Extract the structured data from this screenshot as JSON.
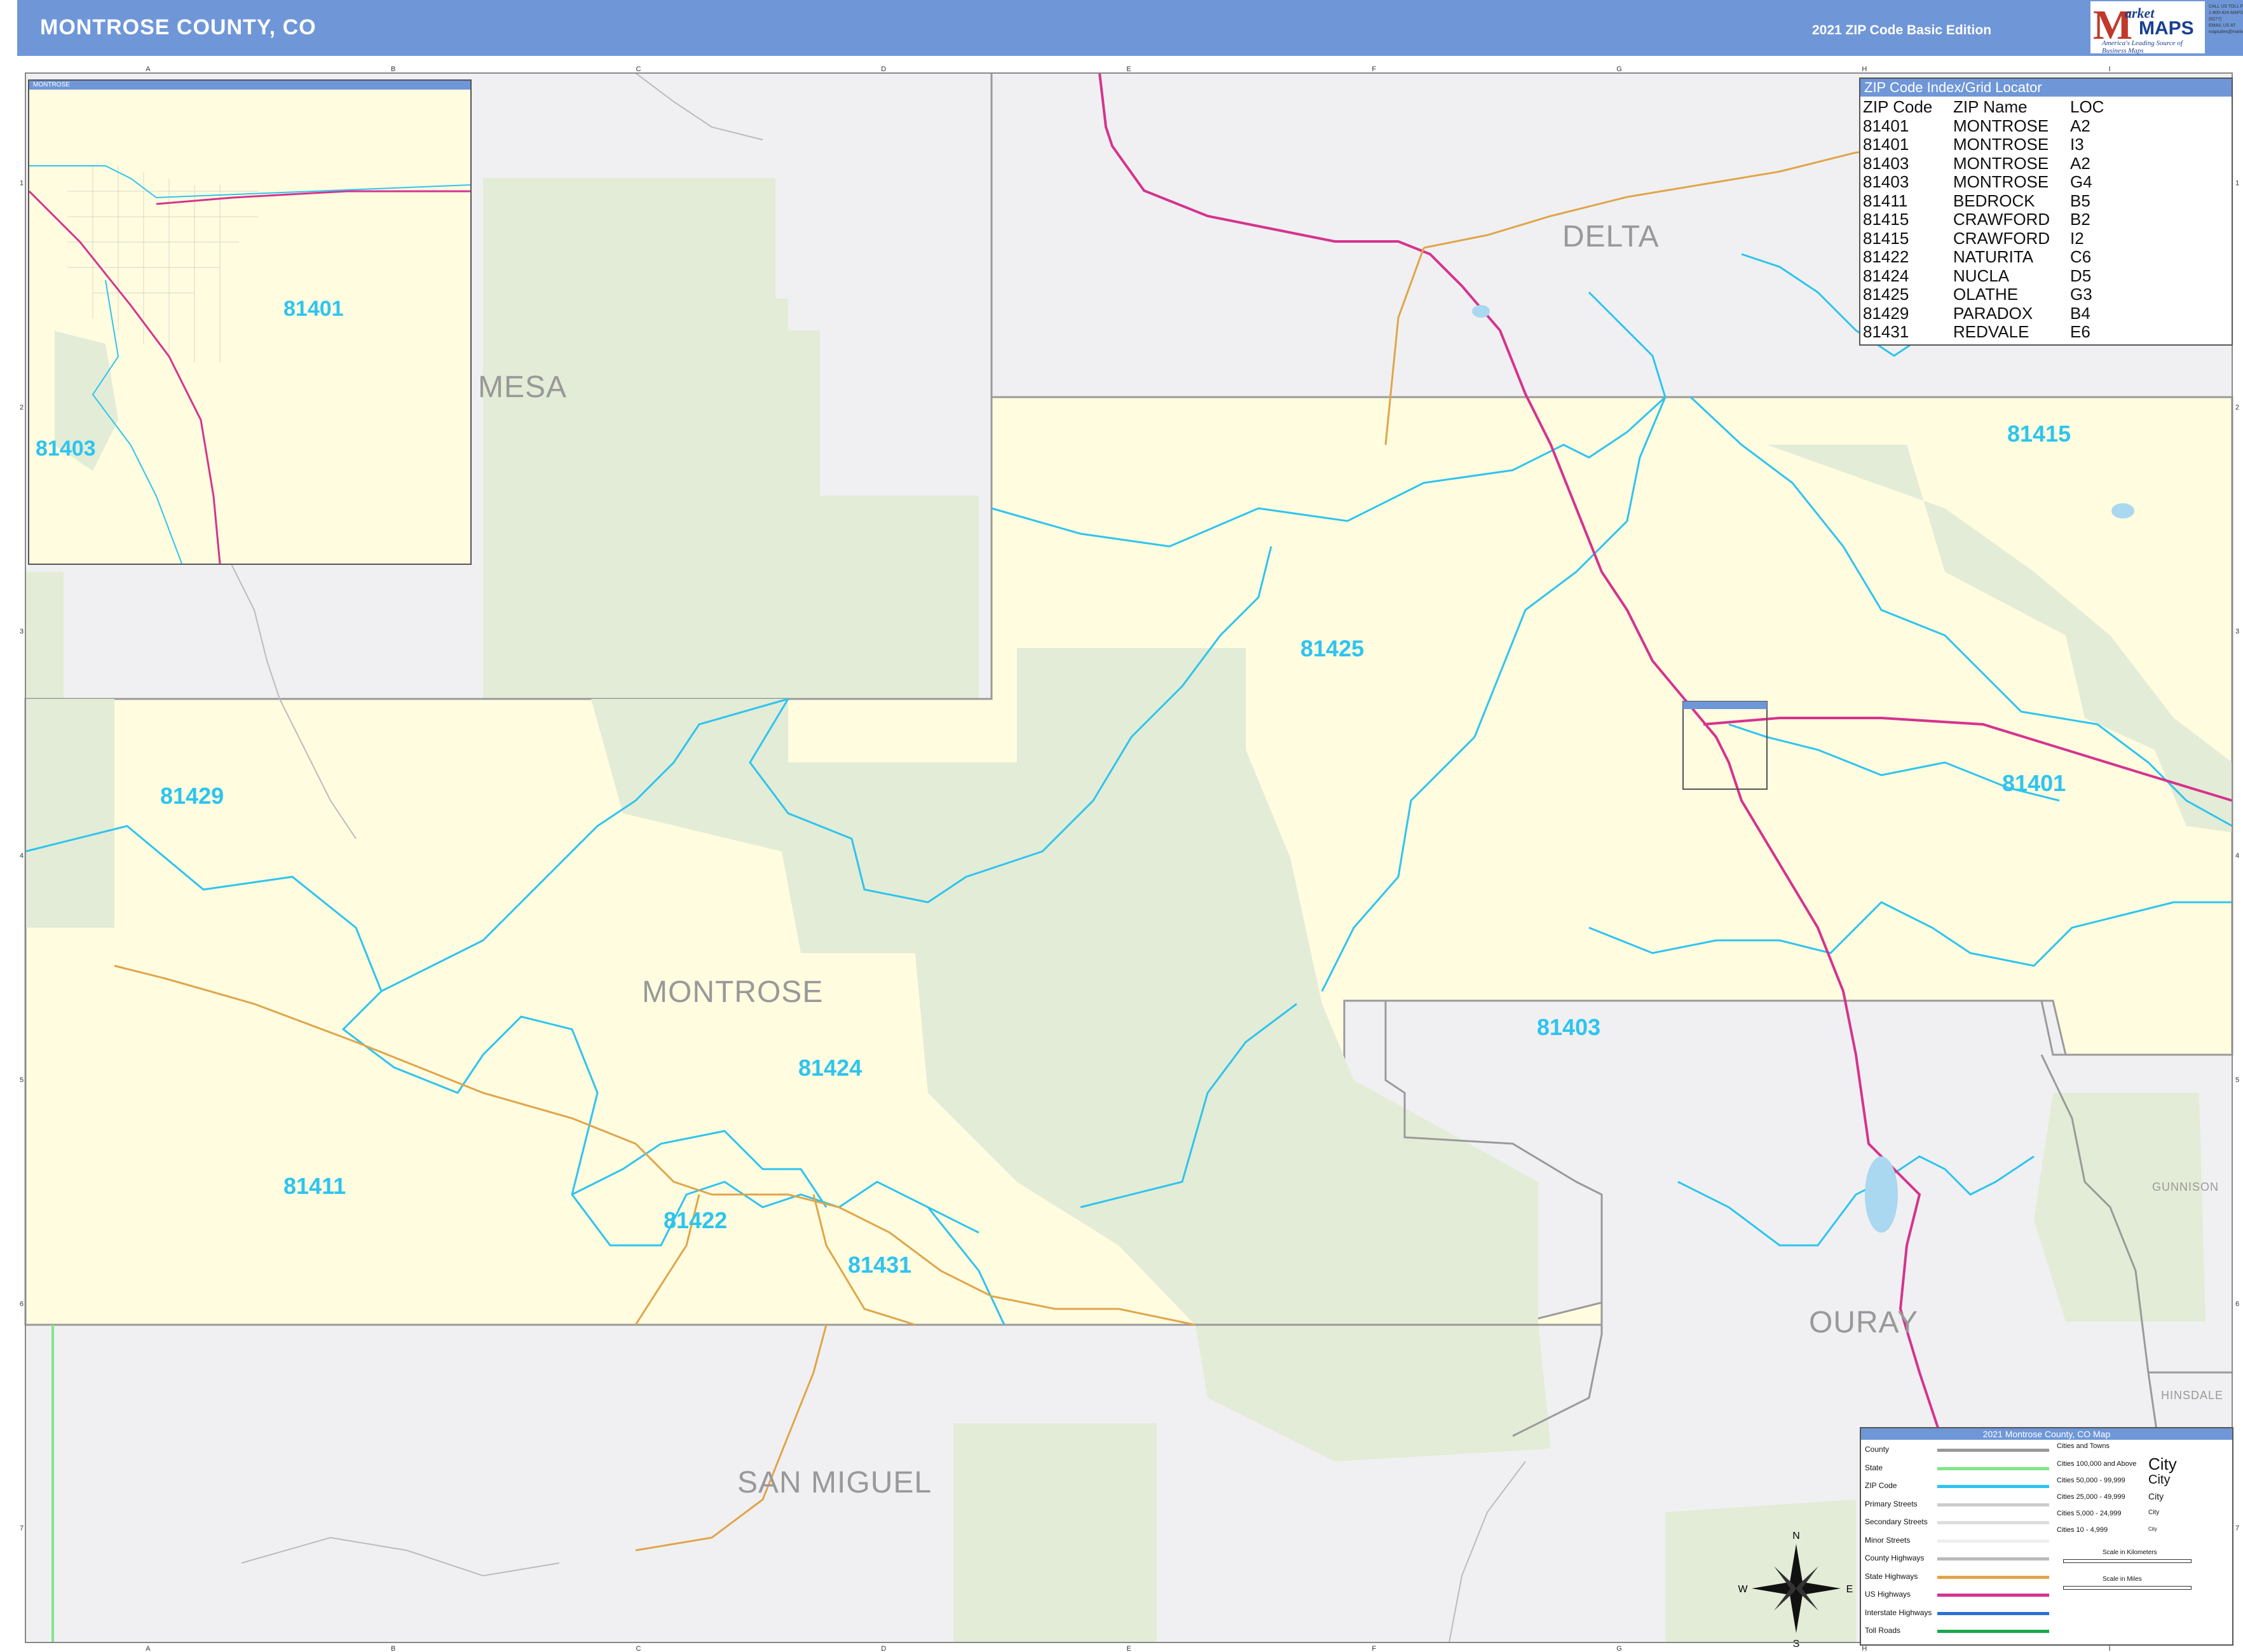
{
  "header": {
    "title": "MONTROSE COUNTY, CO",
    "edition": "2021 ZIP Code Basic Edition",
    "logo_text_a": "M",
    "logo_text_b": "arket",
    "logo_text_c": "MAPS",
    "logo_tagline": "America's Leading Source of Business Maps",
    "contact_line1": "CALL US TOLL FREE",
    "contact_line2": "1-800-424-MAPS (6277)",
    "contact_line3": "EMAIL US AT",
    "contact_line4": "mapsales@marketmaps.com"
  },
  "grid": {
    "columns": [
      "A",
      "B",
      "C",
      "D",
      "E",
      "F",
      "G",
      "H",
      "I"
    ],
    "rows": [
      "1",
      "2",
      "3",
      "4",
      "5",
      "6",
      "7"
    ]
  },
  "inset": {
    "title": "MONTROSE",
    "zips": [
      "81401",
      "81403"
    ]
  },
  "zip_index": {
    "title": "ZIP Code Index/Grid Locator",
    "headers": [
      "ZIP Code",
      "ZIP Name",
      "LOC"
    ],
    "rows": [
      [
        "81401",
        "MONTROSE",
        "A2"
      ],
      [
        "81401",
        "MONTROSE",
        "I3"
      ],
      [
        "81403",
        "MONTROSE",
        "A2"
      ],
      [
        "81403",
        "MONTROSE",
        "G4"
      ],
      [
        "81411",
        "BEDROCK",
        "B5"
      ],
      [
        "81415",
        "CRAWFORD",
        "B2"
      ],
      [
        "81415",
        "CRAWFORD",
        "I2"
      ],
      [
        "81422",
        "NATURITA",
        "C6"
      ],
      [
        "81424",
        "NUCLA",
        "D5"
      ],
      [
        "81425",
        "OLATHE",
        "G3"
      ],
      [
        "81429",
        "PARADOX",
        "B4"
      ],
      [
        "81431",
        "REDVALE",
        "E6"
      ]
    ]
  },
  "regions": {
    "delta": "DELTA",
    "mesa": "MESA",
    "montrose": "MONTROSE",
    "ouray": "OURAY",
    "san_miguel": "SAN MIGUEL",
    "gunnison": "GUNNISON",
    "hinsdale": "HINSDALE"
  },
  "zip_labels": {
    "z81415": "81415",
    "z81425": "81425",
    "z81401": "81401",
    "z81429": "81429",
    "z81424": "81424",
    "z81403": "81403",
    "z81411": "81411",
    "z81422": "81422",
    "z81431": "81431"
  },
  "legend": {
    "title": "2021 Montrose County, CO Map",
    "rows": [
      "County",
      "State",
      "ZIP Code",
      "Primary Streets",
      "Secondary Streets",
      "Minor Streets",
      "County Highways",
      "State Highways",
      "US Highways",
      "Interstate Highways",
      "Toll Roads"
    ],
    "cities_heading": "Cities and Towns",
    "cities": [
      "Cities 100,000 and Above",
      "Cities 50,000 - 99,999",
      "Cities 25,000 - 49,999",
      "Cities 5,000 - 24,999",
      "Cities 10 - 4,999"
    ],
    "city_samples": [
      "City",
      "City",
      "City",
      "City",
      "City"
    ],
    "scale_km": "Scale in Kilometers",
    "scale_mi": "Scale in Miles",
    "colors": {
      "county": "#999999",
      "state": "#7ee68a",
      "zip": "#2ec4ef",
      "primary": "#cccccc",
      "secondary": "#dddddd",
      "minor": "#eeeeee",
      "county_hwy": "#bbbbbb",
      "state_hwy": "#e0a54a",
      "us_hwy": "#d6338e",
      "interstate": "#2a6fd6",
      "toll": "#17a84a"
    }
  },
  "compass": {
    "n": "N",
    "s": "S",
    "e": "E",
    "w": "W"
  },
  "colors": {
    "header": "#6f97d8",
    "county_fill": "#fffce0",
    "forest_fill": "#e3ecd6",
    "outside_fill": "#f0f0f2",
    "zip_line": "#2ec4ef",
    "us_highway": "#d6338e",
    "state_highway": "#e0a54a",
    "county_line": "#9a9a9a",
    "state_line": "#7ee68a"
  }
}
